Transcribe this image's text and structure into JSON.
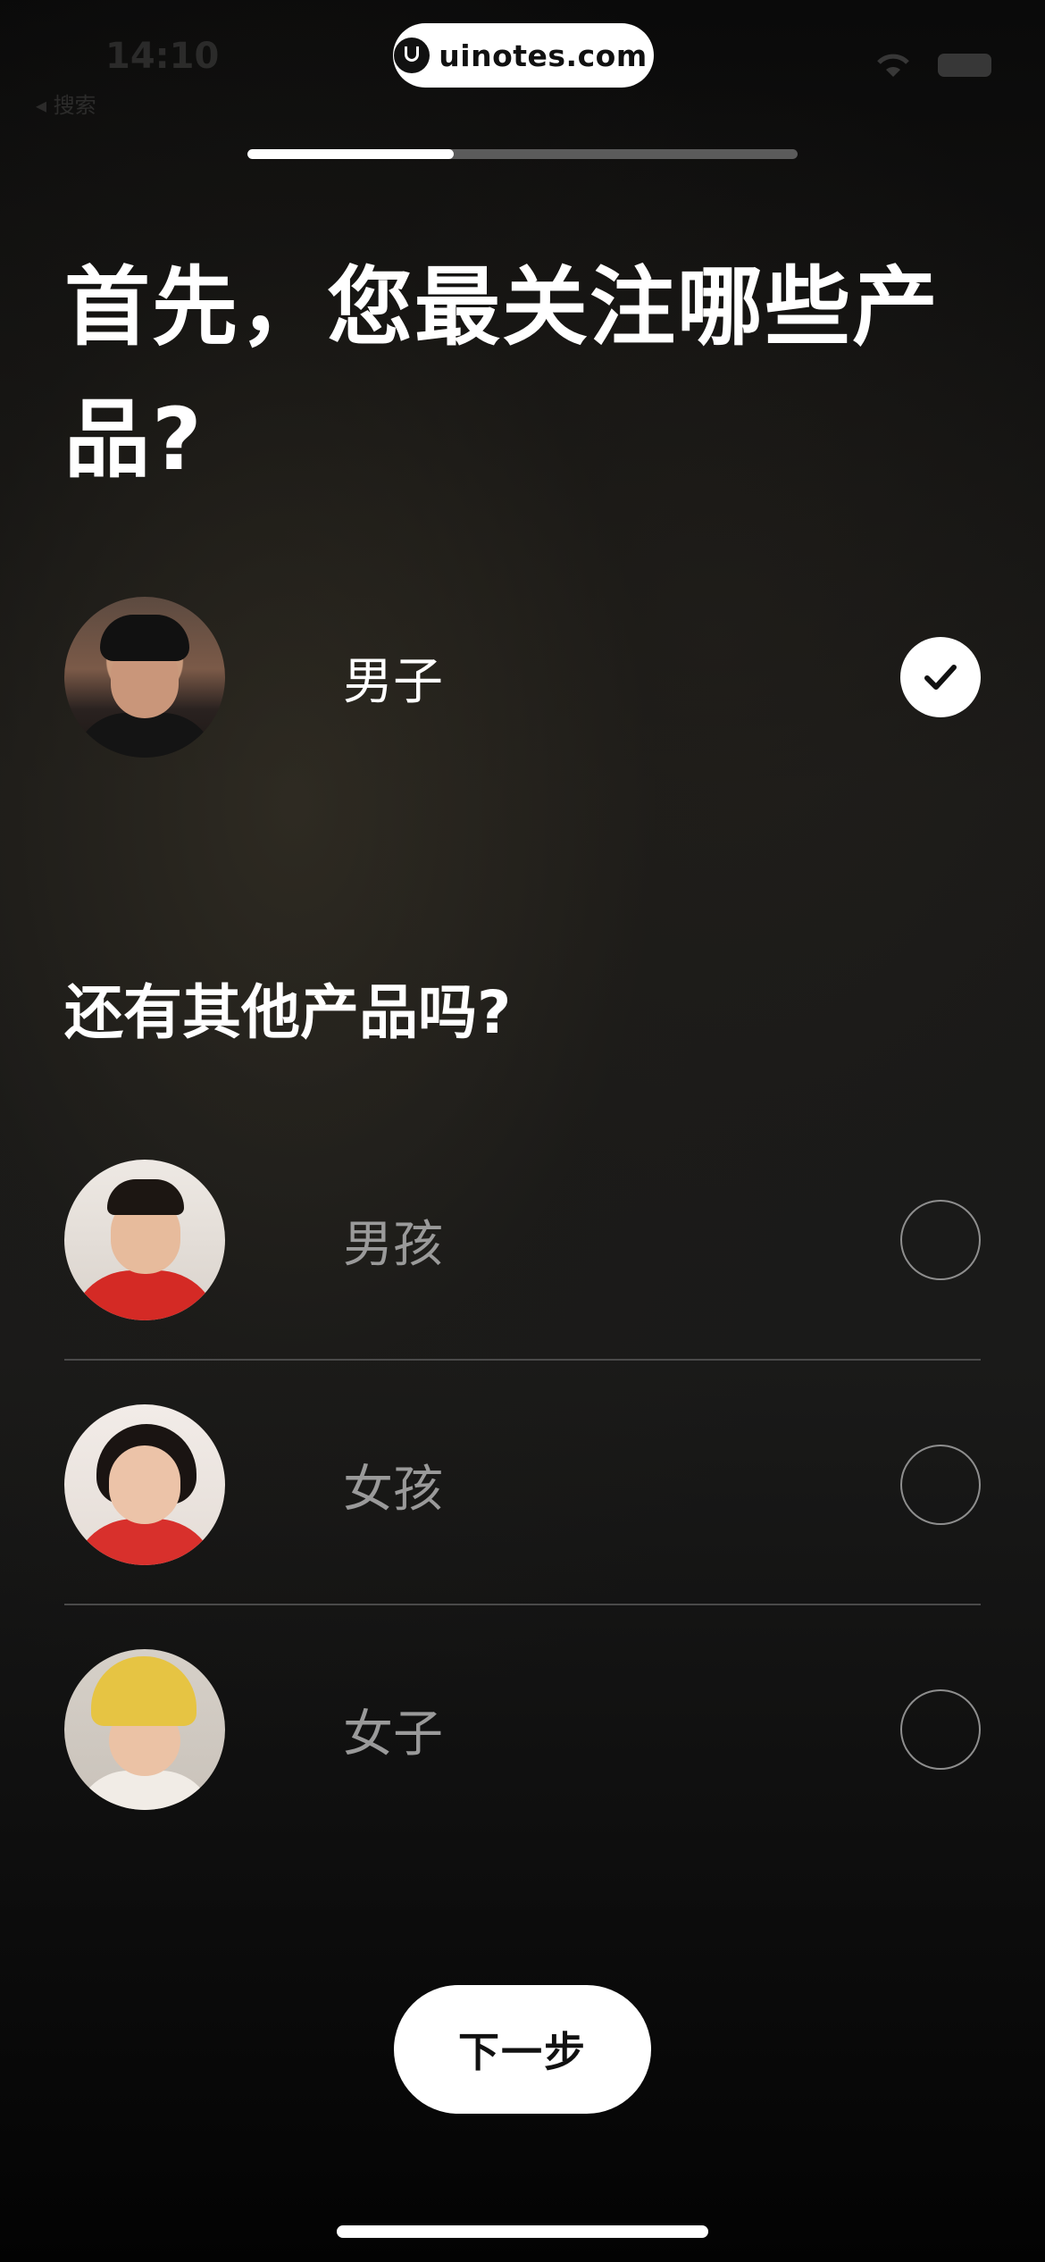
{
  "status_bar": {
    "time": "14:10",
    "sub": "◂ 搜索"
  },
  "watermark": {
    "text": "uinotes.com"
  },
  "progress": {
    "value": 0.375
  },
  "heading": "首先，您最关注哪些产品?",
  "primary_option": {
    "label": "男子",
    "selected": true,
    "avatar": "man-photo"
  },
  "subheading": "还有其他产品吗?",
  "other_options": [
    {
      "label": "男孩",
      "selected": false,
      "avatar": "boy-photo"
    },
    {
      "label": "女孩",
      "selected": false,
      "avatar": "girl-photo"
    },
    {
      "label": "女子",
      "selected": false,
      "avatar": "woman-photo"
    }
  ],
  "next_button": {
    "label": "下一步"
  },
  "icons": {
    "check": "check-icon",
    "wifi": "wifi-icon",
    "battery": "battery-icon"
  }
}
